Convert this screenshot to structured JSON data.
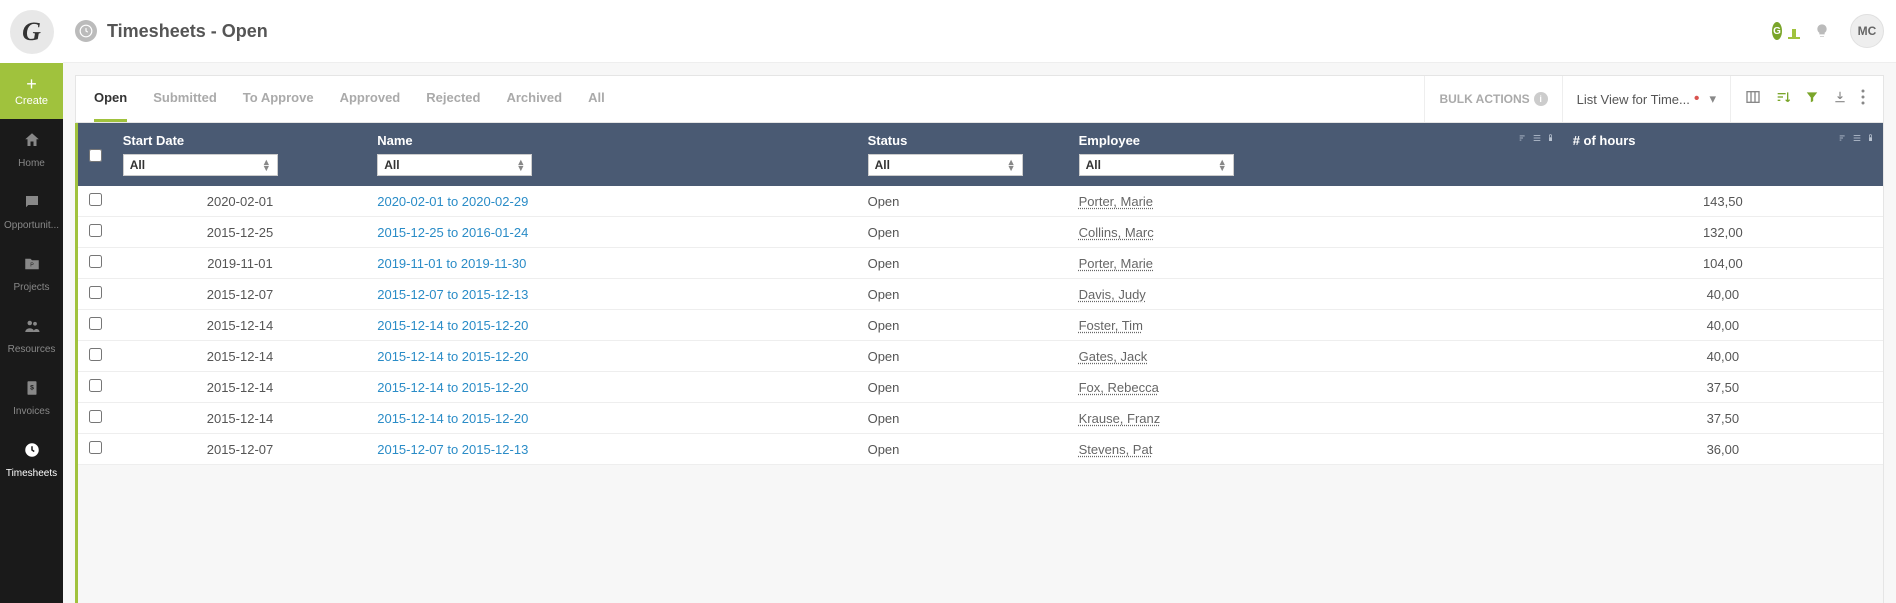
{
  "logo_letter": "G",
  "create_label": "Create",
  "nav": [
    {
      "icon": "home",
      "label": "Home"
    },
    {
      "icon": "chat",
      "label": "Opportunit..."
    },
    {
      "icon": "folder",
      "label": "Projects"
    },
    {
      "icon": "people",
      "label": "Resources"
    },
    {
      "icon": "invoice",
      "label": "Invoices"
    },
    {
      "icon": "clock",
      "label": "Timesheets",
      "active": true
    }
  ],
  "header": {
    "title": "Timesheets - Open",
    "user_initials": "MC",
    "badge_letter": "G"
  },
  "tabs": [
    "Open",
    "Submitted",
    "To Approve",
    "Approved",
    "Rejected",
    "Archived",
    "All"
  ],
  "active_tab": "Open",
  "bulk_actions_label": "BULK ACTIONS",
  "view_label": "List View for Time...",
  "table": {
    "columns": [
      "Start Date",
      "Name",
      "Status",
      "Employee",
      "# of hours"
    ],
    "filter_default": "All",
    "rows": [
      {
        "start": "2020-02-01",
        "name": "2020-02-01 to 2020-02-29",
        "status": "Open",
        "employee": "Porter, Marie",
        "hours": "143,50"
      },
      {
        "start": "2015-12-25",
        "name": "2015-12-25 to 2016-01-24",
        "status": "Open",
        "employee": "Collins, Marc",
        "hours": "132,00"
      },
      {
        "start": "2019-11-01",
        "name": "2019-11-01 to 2019-11-30",
        "status": "Open",
        "employee": "Porter, Marie",
        "hours": "104,00"
      },
      {
        "start": "2015-12-07",
        "name": "2015-12-07 to 2015-12-13",
        "status": "Open",
        "employee": "Davis, Judy",
        "hours": "40,00"
      },
      {
        "start": "2015-12-14",
        "name": "2015-12-14 to 2015-12-20",
        "status": "Open",
        "employee": "Foster, Tim",
        "hours": "40,00"
      },
      {
        "start": "2015-12-14",
        "name": "2015-12-14 to 2015-12-20",
        "status": "Open",
        "employee": "Gates, Jack",
        "hours": "40,00"
      },
      {
        "start": "2015-12-14",
        "name": "2015-12-14 to 2015-12-20",
        "status": "Open",
        "employee": "Fox, Rebecca",
        "hours": "37,50"
      },
      {
        "start": "2015-12-14",
        "name": "2015-12-14 to 2015-12-20",
        "status": "Open",
        "employee": "Krause, Franz",
        "hours": "37,50"
      },
      {
        "start": "2015-12-07",
        "name": "2015-12-07 to 2015-12-13",
        "status": "Open",
        "employee": "Stevens, Pat",
        "hours": "36,00"
      }
    ]
  }
}
